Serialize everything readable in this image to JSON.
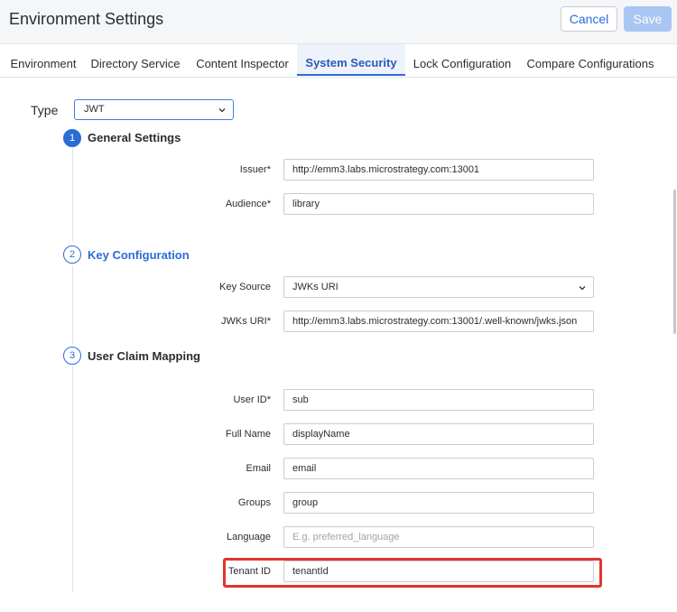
{
  "header": {
    "title": "Environment Settings",
    "cancel_label": "Cancel",
    "save_label": "Save"
  },
  "tabs": [
    {
      "label": "Environment",
      "active": false
    },
    {
      "label": "Directory Service",
      "active": false
    },
    {
      "label": "Content Inspector",
      "active": false
    },
    {
      "label": "System Security",
      "active": true
    },
    {
      "label": "Lock Configuration",
      "active": false
    },
    {
      "label": "Compare Configurations",
      "active": false
    }
  ],
  "type": {
    "label": "Type",
    "value": "JWT"
  },
  "steps": [
    {
      "number": "1",
      "title": "General Settings",
      "fields": [
        {
          "label": "Issuer*",
          "value": "http://emm3.labs.microstrategy.com:13001"
        },
        {
          "label": "Audience*",
          "value": "library"
        }
      ]
    },
    {
      "number": "2",
      "title": "Key Configuration",
      "fields": [
        {
          "label": "Key Source",
          "value": "JWKs URI"
        },
        {
          "label": "JWKs URI*",
          "value": "http://emm3.labs.microstrategy.com:13001/.well-known/jwks.json"
        }
      ]
    },
    {
      "number": "3",
      "title": "User Claim Mapping",
      "fields": [
        {
          "label": "User ID*",
          "value": "sub"
        },
        {
          "label": "Full Name",
          "value": "displayName"
        },
        {
          "label": "Email",
          "value": "email"
        },
        {
          "label": "Groups",
          "value": "group"
        },
        {
          "label": "Language",
          "value": "",
          "placeholder": "E.g. preferred_language"
        },
        {
          "label": "Tenant ID",
          "value": "tenantId"
        }
      ]
    }
  ],
  "icons": {
    "dropdown": "chevron-down-icon"
  },
  "colors": {
    "accent": "#2b6cd6",
    "highlight": "#e0352b",
    "save_disabled": "#a9c5f2"
  }
}
